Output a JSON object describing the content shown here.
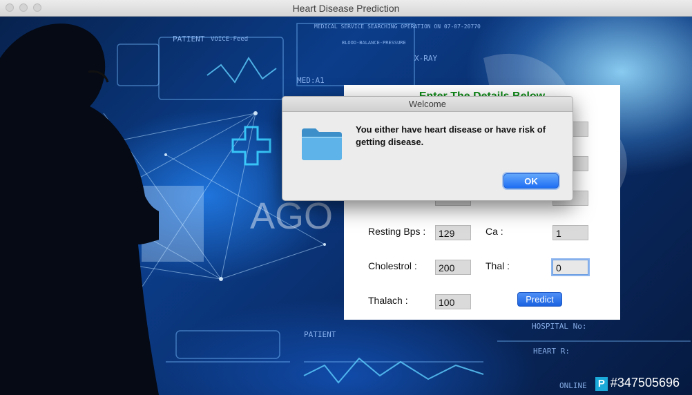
{
  "window": {
    "title": "Heart Disease Prediction"
  },
  "background_text": {
    "patient_top": "PATIENT",
    "voice_feed": "VOICE-Feed",
    "medical_service": "MEDICAL SERVICE  SEARCHING OPERATION ON 07-07-20770",
    "blood_pressure": "BLOOD-BALANCE-PRESSURE",
    "xray": "X-RAY",
    "med": "MED:A1",
    "patient_bottom": "PATIENT",
    "hospital": "HOSPITAL No:",
    "heart_r": "HEART R:",
    "online": "ONLINE",
    "agency": "AGO",
    "watermark_id": "#347505696",
    "watermark_letter": "P"
  },
  "form": {
    "title": "Enter The Details Below",
    "resting_bps_label": "Resting Bps :",
    "resting_bps_value": "129",
    "ca_label": "Ca :",
    "ca_value": "1",
    "cholestrol_label": "Cholestrol :",
    "cholestrol_value": "200",
    "thal_label": "Thal :",
    "thal_value": "0",
    "thalach_label": "Thalach :",
    "thalach_value": "100",
    "predict_label": "Predict"
  },
  "dialog": {
    "title": "Welcome",
    "message": "You either have heart disease or have risk of getting disease.",
    "ok_label": "OK"
  },
  "colors": {
    "accent": "#1e6ef3",
    "form_title": "#0e8a17"
  }
}
